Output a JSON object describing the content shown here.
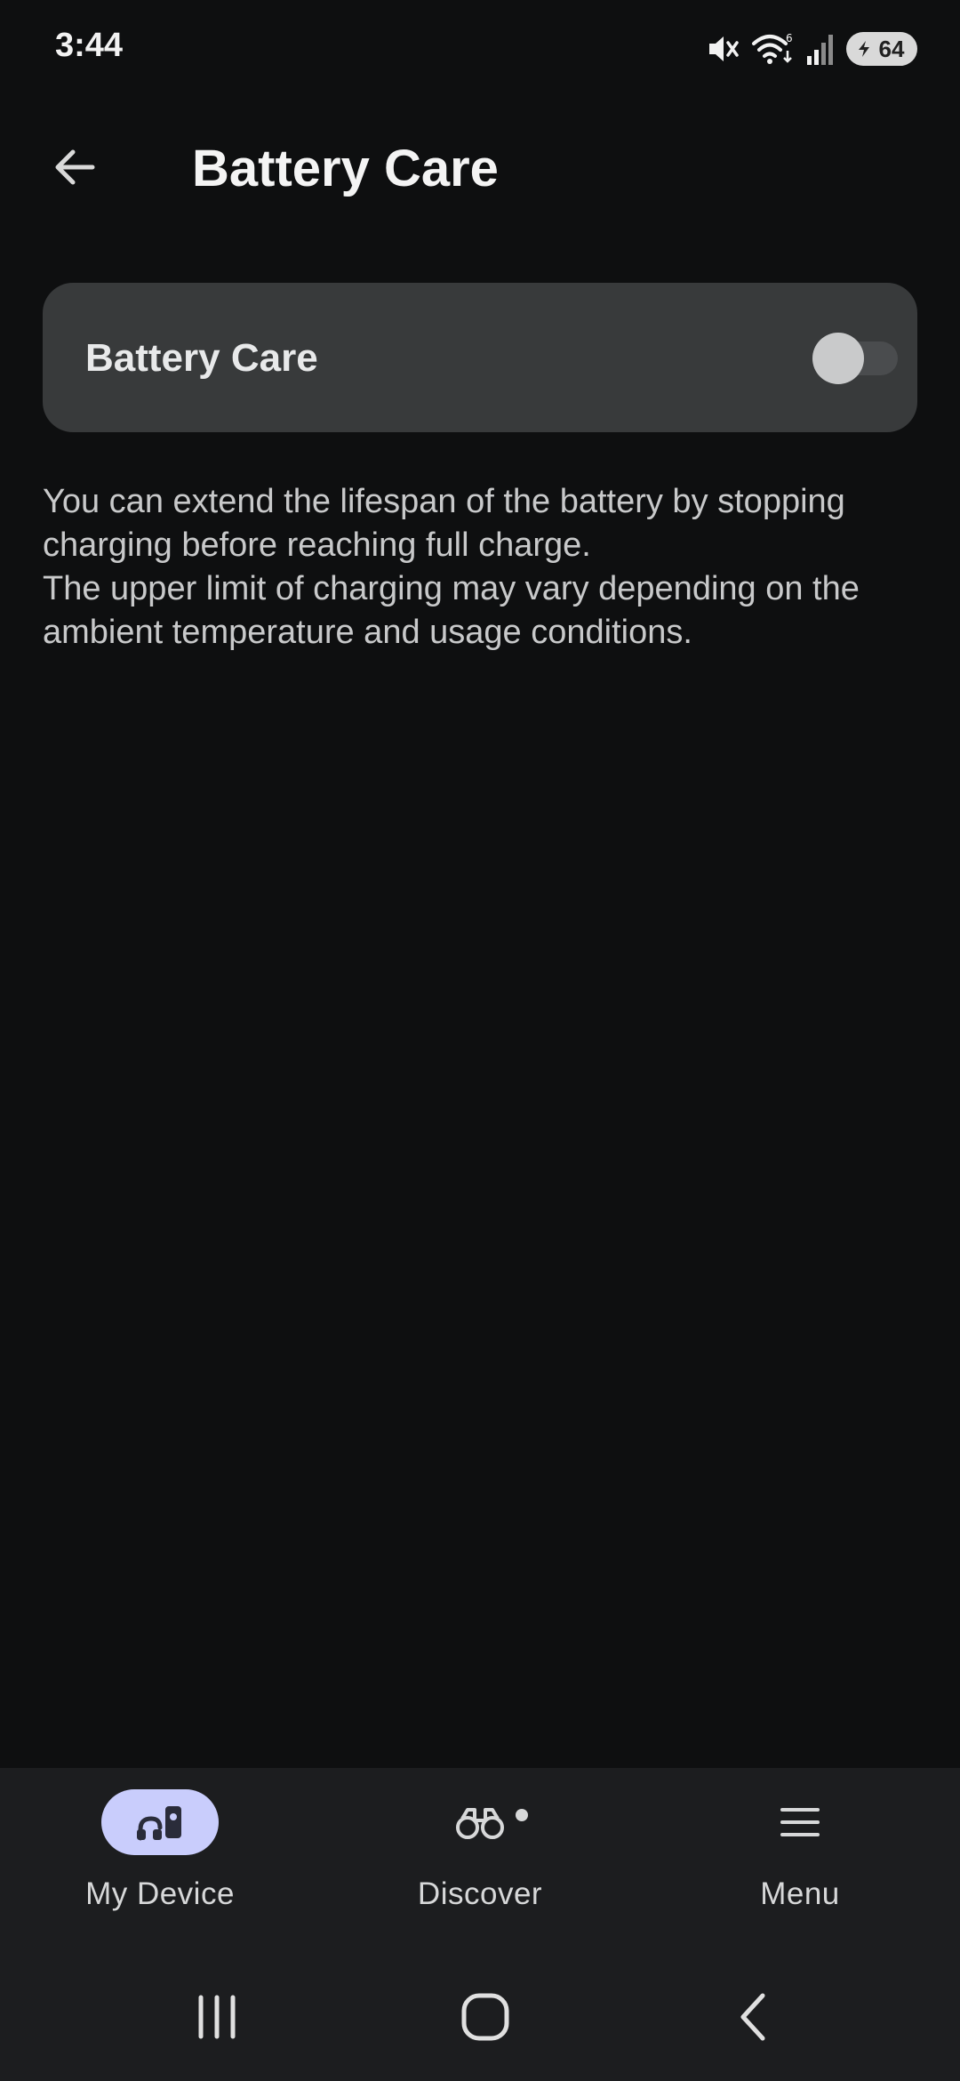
{
  "status_bar": {
    "time": "3:44",
    "battery_level": "64",
    "icons": [
      "mute-icon",
      "wifi-icon",
      "signal-icon",
      "battery-icon"
    ]
  },
  "header": {
    "title": "Battery Care",
    "back_icon": "arrow-left-icon"
  },
  "battery_care": {
    "label": "Battery Care",
    "enabled": false
  },
  "description": {
    "line1": "You can extend the lifespan of the battery by stopping charging before reaching full charge.",
    "line2": "The upper limit of charging may vary depending on the ambient temperature and usage conditions."
  },
  "bottom_nav": {
    "items": [
      {
        "label": "My Device",
        "icon": "earbuds-case-icon",
        "active": true
      },
      {
        "label": "Discover",
        "icon": "binoculars-icon",
        "active": false,
        "badge": true
      },
      {
        "label": "Menu",
        "icon": "hamburger-menu-icon",
        "active": false
      }
    ]
  },
  "colors": {
    "background": "#0e0f10",
    "card": "#383a3b",
    "nav_background": "#1c1d1f",
    "active_pill": "#c9cdfc"
  }
}
